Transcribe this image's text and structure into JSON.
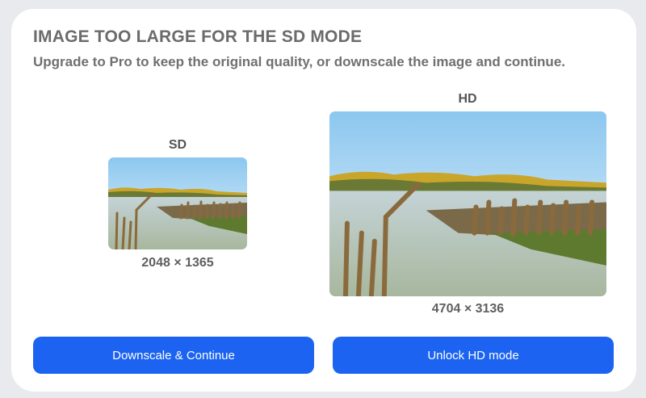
{
  "dialog": {
    "title": "IMAGE TOO LARGE FOR THE SD MODE",
    "subtitle": "Upgrade to Pro to keep the original quality, or downscale the image and continue."
  },
  "sd": {
    "label": "SD",
    "dimensions": "2048 × 1365"
  },
  "hd": {
    "label": "HD",
    "dimensions": "4704 × 3136"
  },
  "actions": {
    "downscale_label": "Downscale & Continue",
    "unlock_label": "Unlock HD mode"
  },
  "colors": {
    "primary": "#1b63f0",
    "title": "#6b6b6b",
    "background": "#ffffff"
  }
}
